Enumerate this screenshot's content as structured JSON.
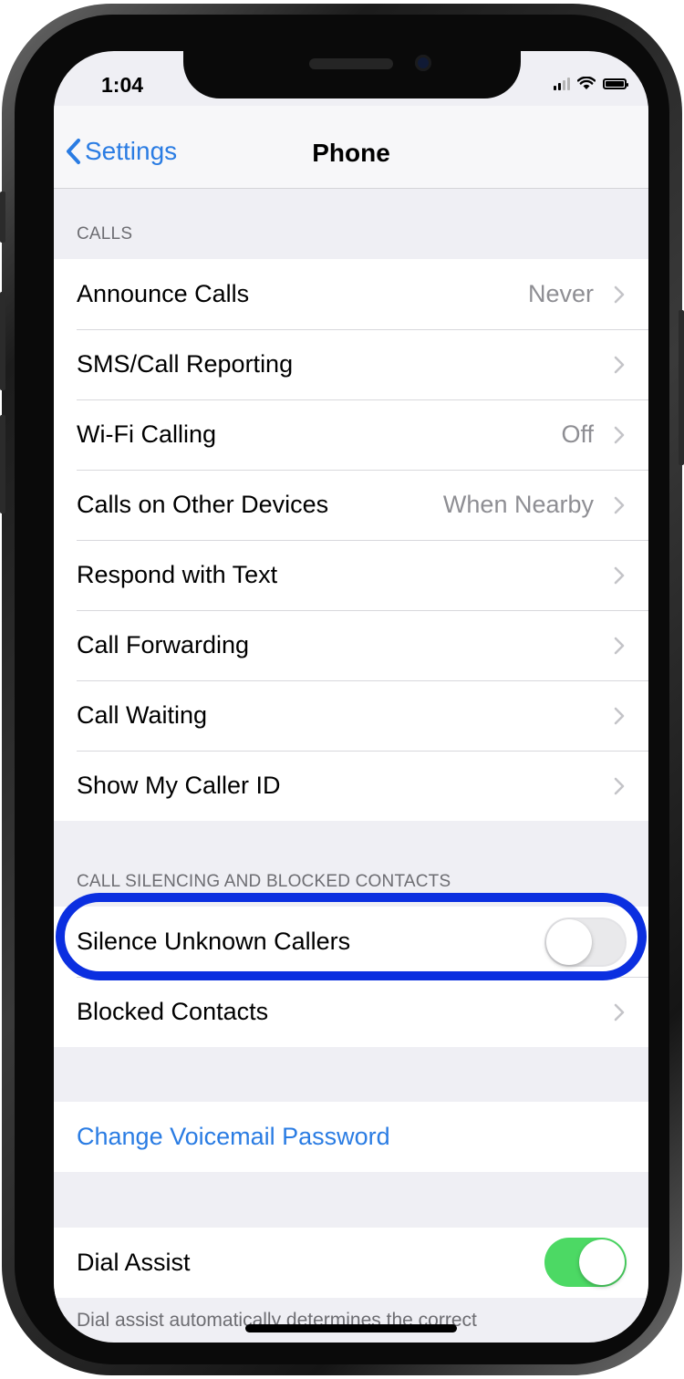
{
  "status_bar": {
    "time": "1:04"
  },
  "nav": {
    "back_label": "Settings",
    "title": "Phone"
  },
  "calls": {
    "header": "CALLS",
    "rows": [
      {
        "label": "Announce Calls",
        "value": "Never"
      },
      {
        "label": "SMS/Call Reporting",
        "value": ""
      },
      {
        "label": "Wi-Fi Calling",
        "value": "Off"
      },
      {
        "label": "Calls on Other Devices",
        "value": "When Nearby"
      },
      {
        "label": "Respond with Text",
        "value": ""
      },
      {
        "label": "Call Forwarding",
        "value": ""
      },
      {
        "label": "Call Waiting",
        "value": ""
      },
      {
        "label": "Show My Caller ID",
        "value": ""
      }
    ]
  },
  "silencing": {
    "header": "CALL SILENCING AND BLOCKED CONTACTS",
    "silence_unknown_label": "Silence Unknown Callers",
    "silence_unknown_on": false,
    "blocked_contacts_label": "Blocked Contacts"
  },
  "voicemail": {
    "change_password_label": "Change Voicemail Password"
  },
  "dial_assist": {
    "label": "Dial Assist",
    "on": true,
    "footer": "Dial assist automatically determines the correct"
  },
  "colors": {
    "accent": "#2a7ce3",
    "toggle_on": "#4cd964",
    "highlight": "#0b2fe0",
    "group_bg": "#efeff4"
  }
}
